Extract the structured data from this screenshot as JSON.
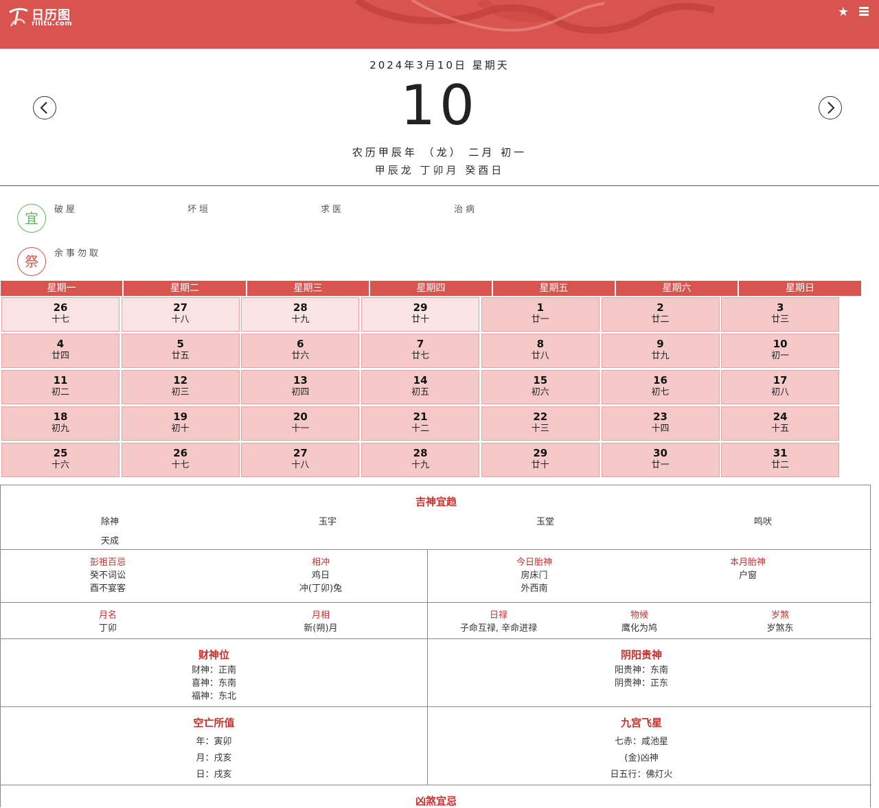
{
  "header": {
    "logo_name": "日历图",
    "logo_domain": "rilitu.com",
    "star_glyph": "★",
    "menu_glyph": "≡"
  },
  "date": {
    "solar_line": "2024年3月10日 星期天",
    "day": "10",
    "lunar_line": "农历甲辰年 （龙） 二月 初一",
    "ganzhi_line": "甲辰龙 丁卯月 癸酉日"
  },
  "yi": {
    "badge": "宜",
    "items": [
      "破屋",
      "坏垣",
      "求医",
      "治病"
    ]
  },
  "ji": {
    "badge": "祭",
    "items": [
      "余事勿取"
    ]
  },
  "calendar": {
    "weekdays": [
      "星期一",
      "星期二",
      "星期三",
      "星期四",
      "星期五",
      "星期六",
      "星期日"
    ],
    "days": [
      {
        "n": "26",
        "l": "十七",
        "other": true
      },
      {
        "n": "27",
        "l": "十八",
        "other": true
      },
      {
        "n": "28",
        "l": "十九",
        "other": true
      },
      {
        "n": "29",
        "l": "廿十",
        "other": true
      },
      {
        "n": "1",
        "l": "廿一"
      },
      {
        "n": "2",
        "l": "廿二"
      },
      {
        "n": "3",
        "l": "廿三"
      },
      {
        "n": "4",
        "l": "廿四"
      },
      {
        "n": "5",
        "l": "廿五"
      },
      {
        "n": "6",
        "l": "廿六"
      },
      {
        "n": "7",
        "l": "廿七"
      },
      {
        "n": "8",
        "l": "廿八"
      },
      {
        "n": "9",
        "l": "廿九"
      },
      {
        "n": "10",
        "l": "初一"
      },
      {
        "n": "11",
        "l": "初二"
      },
      {
        "n": "12",
        "l": "初三"
      },
      {
        "n": "13",
        "l": "初四"
      },
      {
        "n": "14",
        "l": "初五"
      },
      {
        "n": "15",
        "l": "初六"
      },
      {
        "n": "16",
        "l": "初七"
      },
      {
        "n": "17",
        "l": "初八"
      },
      {
        "n": "18",
        "l": "初九"
      },
      {
        "n": "19",
        "l": "初十"
      },
      {
        "n": "20",
        "l": "十一"
      },
      {
        "n": "21",
        "l": "十二"
      },
      {
        "n": "22",
        "l": "十三"
      },
      {
        "n": "23",
        "l": "十四"
      },
      {
        "n": "24",
        "l": "十五"
      },
      {
        "n": "25",
        "l": "十六"
      },
      {
        "n": "26",
        "l": "十七"
      },
      {
        "n": "27",
        "l": "十八"
      },
      {
        "n": "28",
        "l": "十九"
      },
      {
        "n": "29",
        "l": "廿十"
      },
      {
        "n": "30",
        "l": "廿一"
      },
      {
        "n": "31",
        "l": "廿二"
      }
    ]
  },
  "info": {
    "jishen": {
      "title": "吉神宜趋",
      "items": [
        "除神",
        "玉宇",
        "玉堂",
        "鸣吠",
        "天成"
      ]
    },
    "pengzu": {
      "label": "彭祖百忌",
      "line1": "癸不词讼",
      "line2": "酉不宴客"
    },
    "xiangchong": {
      "label": "相冲",
      "line1": "鸡日",
      "line2": "冲(丁卯)兔"
    },
    "jinri_taishen": {
      "label": "今日胎神",
      "line1": "房床门",
      "line2": "外西南"
    },
    "benyue_taishen": {
      "label": "本月胎神",
      "line1": "户窗"
    },
    "yueming": {
      "label": "月名",
      "value": "丁卯"
    },
    "yuexiang": {
      "label": "月相",
      "value": "新(朔)月"
    },
    "rilu": {
      "label": "日禄",
      "value": "子命互禄, 辛命进禄"
    },
    "wuhou": {
      "label": "物候",
      "value": "鹰化为鸠"
    },
    "suisha": {
      "label": "岁煞",
      "value": "岁煞东"
    },
    "caishen": {
      "title": "财神位",
      "lines": [
        "财神：正南",
        "喜神：东南",
        "福神：东北"
      ]
    },
    "yinyang": {
      "title": "阴阳贵神",
      "lines": [
        "阳贵神：东南",
        "阴贵神：正东"
      ]
    },
    "kongwang": {
      "title": "空亡所值",
      "lines": [
        "年：寅卯",
        "月：戌亥",
        "日：戌亥"
      ]
    },
    "jiugong": {
      "title": "九宫飞星",
      "lines": [
        "七赤：咸池星",
        "(金)凶神",
        "日五行：佛灯火"
      ]
    },
    "xiongsha": {
      "title": "凶煞宜忌"
    }
  }
}
